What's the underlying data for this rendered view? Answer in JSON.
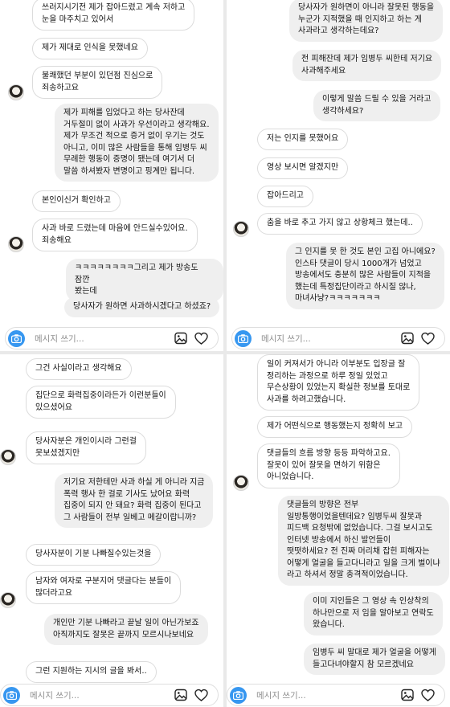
{
  "composer": {
    "placeholder": "메시지 쓰기..."
  },
  "panels": {
    "tl": {
      "messages": [
        "쓰러지시기전 제가 잡아드렸고 계속 저하고\n눈을 마주치고 있어서",
        "제가 제대로 인식을 못했네요",
        "불쾌했던 부분이 있던점 진심으로\n죄송하고요",
        "제가 피해를 입었다고 하는 당사잔데\n거두절미 없이 사과가 우선이라고 생각해요.\n제가 무조건 적으로 증거 없이 우기는 것도\n아니고, 이미 많은 사람들을 통해 임병두 씨\n무례한 행동이 증명이 됐는데 여기서 더\n말씀 하셔봤자 변명이고 핑계만 됩니다.",
        "본인이신거 확인하고",
        "사과 바로 드렸는데 마음에 안드실수있어요.\n죄송해요",
        "ㅋㅋㅋㅋㅋㅋㅋㅋ그리고 제가 방송도 잠깐\n봤는데",
        "당사자가 원하면 사과하시겠다고 하셨죠?"
      ]
    },
    "tr": {
      "messages": [
        "당사자가 원하면이 아니라 잘못된 행동을\n누군가 지적했을 때 인지하고 하는 게\n사과라고 생각하는데요?",
        "전 피해잔데 제가 임병두 씨한테 저기요\n사과해주세요",
        "이렇게 말씀 드릴 수 있을 거라고\n생각하세요?",
        "저는 인지를 못했어요",
        "영상 보시면 알겠지만",
        "잡아드리고",
        "춤을 바로 추고 가지 않고 상황체크 했는데..",
        "그 인지를 못 한 것도 본인 고집 아니에요?\n인스타 댓글이 당시 1000개가 넘었고\n방송에서도 충분히 많은 사람들이 지적을\n했는데 특정집단이라고 하시질 않나,\n마녀사냥?ㅋㅋㅋㅋㅋㅋㅋ"
      ]
    },
    "bl": {
      "messages": [
        "그건 사실이라고 생각해요",
        "집단으로 화력집중이라든가 이런분들이\n있으셨어요",
        "당사자분은 개인이시라  그런걸\n못보셨겠지만",
        "저기요 저한테만 사과 하실 게 아니라 지금\n폭력 행사 한 걸로 기사도 났어요 화력\n집중이 되지 안 돼요? 화력 집중이 된다고\n그 사람들이 전부 일베고 메갈이랍니까?",
        "당사자분이 기분 나빠질수있는것을",
        "남자와 여자로 구분지어 댓글다는 분들이\n많더라고요",
        "개인만 기분 나빠라고 끝날 일이 아닌가보죠\n아직까지도 잘못은 끝까지 모르시나보네요",
        "그런 지원하는 지시의 글을 봐서.."
      ]
    },
    "br": {
      "messages": [
        "일이 커져서가 아니라 이부분도 입장글  잘\n정리하는 과정으로 하루 정일 있었고\n무슨상황이 있었는지 확실한 정보를 토대로\n사과를 하려고했습니다.",
        "제가 어떤식으로 행동했는지 정확히 보고",
        "댓글들의 흐름 방향 등등 파악하고요.\n잘못이 있어 잘못을 면하기 위함은\n아니었습니다.",
        "댓글들의 방향은 전부\n일방통행이었을텐데요? 임병두씨 잘못과\n피드백 요청밖에 없었습니다. 그걸 보시고도\n인터넷 방송에서 하신 발언들이\n떳떳하세요? 전 진짜 머리채 잡힌 피해자는\n어떻게 얼굴을 들고다니라고 일을 크게 벌이냐\n라고 하셔서 정말 충격적이었습니다.",
        "이미 지인들은 그 영상 속 인상착의\n하나만으로 저 임을 알아보고 연락도\n왔습니다.",
        "임병두 씨 말대로 제가 얼굴을 어떻게\n들고다녀야할지 참 모르겠네요"
      ]
    }
  }
}
